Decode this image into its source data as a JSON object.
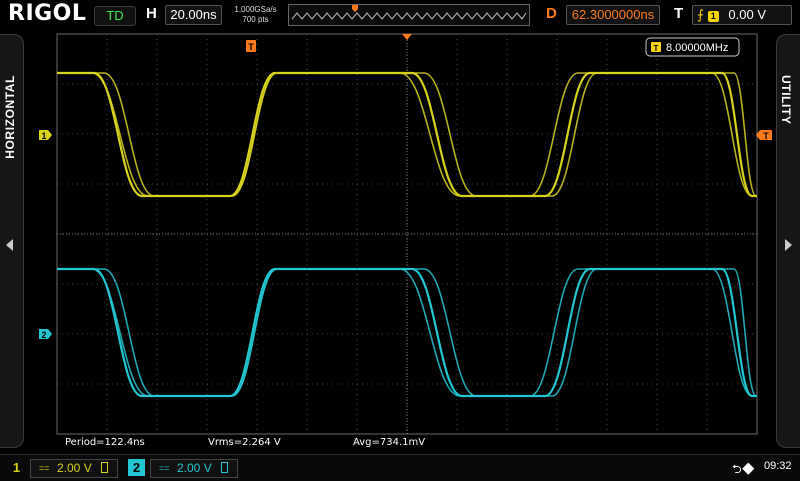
{
  "header": {
    "brand": "RIGOL",
    "run_status": "TD",
    "horizontal_label": "H",
    "horizontal_scale": "20.00ns",
    "sample_rate": "1.000GSa/s",
    "mem_depth": "700 pts",
    "delay_label": "D",
    "delay_value": "62.3000000ns",
    "trigger_label": "T",
    "trigger_source": "1",
    "trigger_level": "0.00 V"
  },
  "side": {
    "left_tab": "HORIZONTAL",
    "right_tab": "UTILITY"
  },
  "frequency_counter": {
    "badge": "T",
    "value": "8.00000MHz"
  },
  "markers": {
    "ch1": "1",
    "ch2": "2",
    "trigger_pos": "T",
    "trigger_level": "T"
  },
  "measurements": {
    "period": "Period=122.4ns",
    "vrms": "Vrms=2.264 V",
    "avg": "Avg=734.1mV"
  },
  "channels": [
    {
      "number": "1",
      "coupling": "==",
      "scale": "2.00 V",
      "color": "#d7d21c"
    },
    {
      "number": "2",
      "coupling": "==",
      "scale": "2.00 V",
      "color": "#22c7d3"
    }
  ],
  "status": {
    "usb": "usb-icon",
    "clock": "09:32"
  },
  "colors": {
    "ch1": "#d7d21c",
    "ch2": "#22c7d3",
    "accent": "#ff7b1c",
    "grid": "#5a5a5a"
  }
}
